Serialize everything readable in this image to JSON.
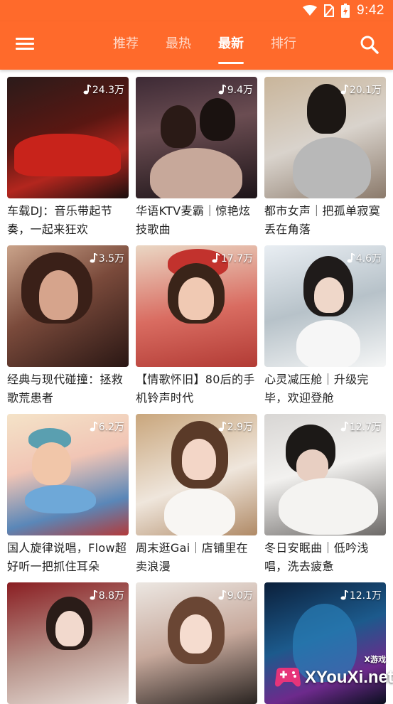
{
  "status": {
    "time": "9:42",
    "icons": [
      "wifi-icon",
      "no-sim-icon",
      "battery-icon"
    ]
  },
  "appbar": {
    "color": "#ff6a2b",
    "tabs": [
      {
        "label": "推荐",
        "active": false
      },
      {
        "label": "最热",
        "active": false
      },
      {
        "label": "最新",
        "active": true
      },
      {
        "label": "排行",
        "active": false
      }
    ]
  },
  "cards": [
    {
      "count": "24.3万",
      "title": "车载DJ：音乐带起节奏，一起来狂欢"
    },
    {
      "count": "9.4万",
      "title": "华语KTV麦霸｜惊艳炫技歌曲"
    },
    {
      "count": "20.1万",
      "title": "都市女声｜把孤单寂寞丢在角落"
    },
    {
      "count": "3.5万",
      "title": "经典与现代碰撞：拯救歌荒患者"
    },
    {
      "count": "17.7万",
      "title": "【情歌怀旧】80后的手机铃声时代"
    },
    {
      "count": "4.6万",
      "title": "心灵减压舱｜升级完毕，欢迎登舱"
    },
    {
      "count": "6.2万",
      "title": "国人旋律说唱，Flow超好听一把抓住耳朵"
    },
    {
      "count": "2.9万",
      "title": "周末逛Gai｜店铺里在卖浪漫"
    },
    {
      "count": "12.7万",
      "title": "冬日安眠曲｜低吟浅唱，洗去疲惫"
    },
    {
      "count": "8.8万",
      "title": ""
    },
    {
      "count": "9.0万",
      "title": ""
    },
    {
      "count": "12.1万",
      "title": ""
    }
  ],
  "watermark": {
    "text": "XYouXi.net",
    "small": "X游戏"
  }
}
